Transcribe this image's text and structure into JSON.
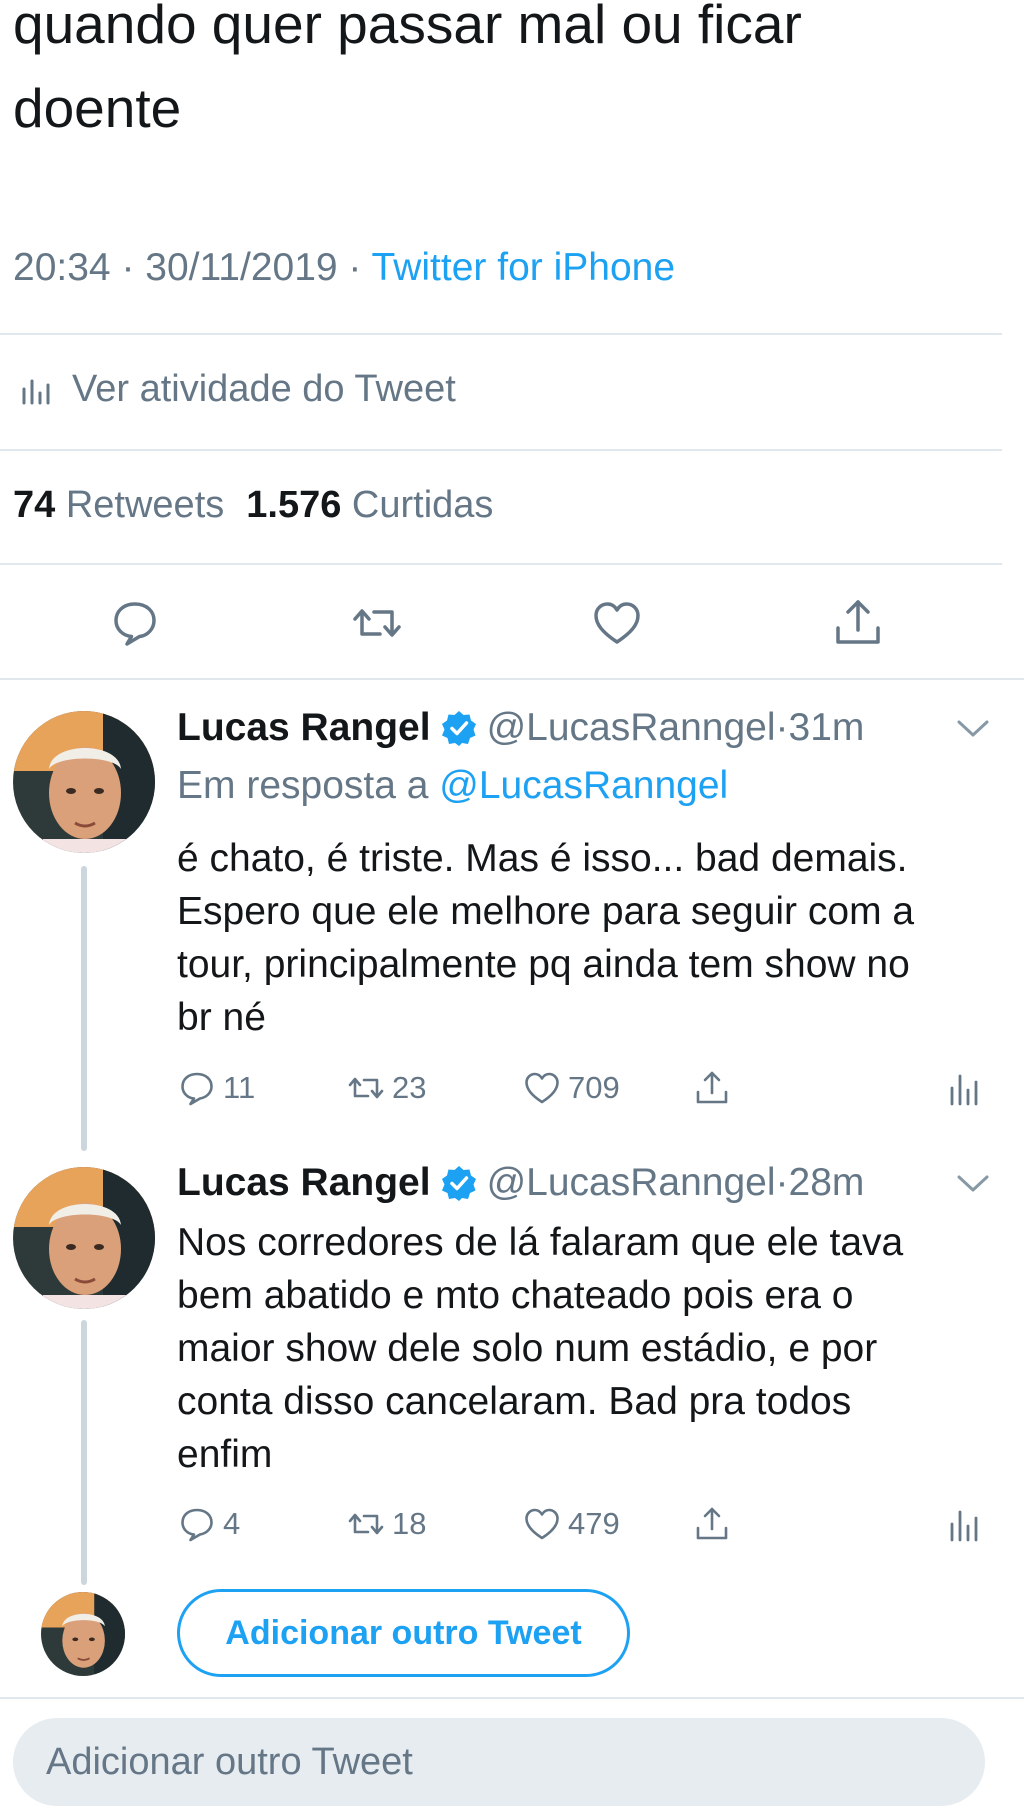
{
  "main_tweet": {
    "text_lines": [
      "quando quer passar mal ou ficar",
      "doente"
    ],
    "time": "20:34",
    "sep1": " · ",
    "date": "30/11/2019",
    "sep2": " · ",
    "source": "Twitter for iPhone",
    "activity_label": "Ver atividade do Tweet",
    "retweets_count": "74",
    "retweets_label": "Retweets",
    "likes_count": "1.576",
    "likes_label": "Curtidas"
  },
  "replies": [
    {
      "name": "Lucas Rangel",
      "handle": "@LucasRanngel",
      "sep": " · ",
      "time": "31m",
      "reply_prefix": "Em resposta a ",
      "reply_to": "@LucasRanngel",
      "text_lines": [
        "é chato, é triste. Mas é isso... bad demais.",
        "Espero que ele melhore para seguir com a",
        "tour, principalmente pq ainda tem show no",
        "br né"
      ],
      "replies": "11",
      "retweets": "23",
      "likes": "709"
    },
    {
      "name": "Lucas Rangel",
      "handle": "@LucasRanngel",
      "sep": " · ",
      "time": "28m",
      "text_lines": [
        "Nos corredores de lá falaram que ele tava",
        "bem abatido e mto chateado pois era o",
        "maior show dele solo num estádio, e por",
        "conta disso cancelaram. Bad pra todos",
        "enfim"
      ],
      "replies": "4",
      "retweets": "18",
      "likes": "479"
    }
  ],
  "add_tweet_button": "Adicionar outro Tweet",
  "compose_placeholder": "Adicionar outro Tweet",
  "colors": {
    "accent": "#1da1f2",
    "muted": "#657786",
    "divider": "#e1e8ed",
    "verified": "#1da1f2"
  }
}
